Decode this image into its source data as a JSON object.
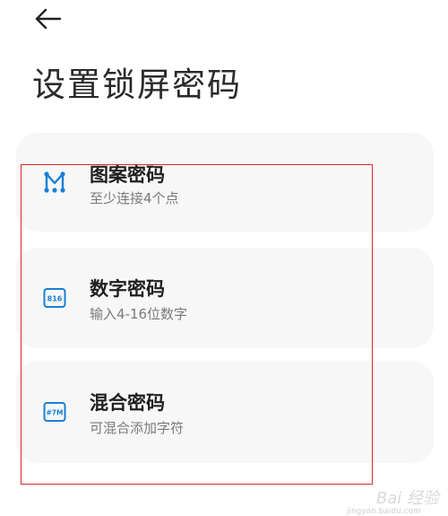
{
  "header": {
    "back_icon": "arrow-left-icon",
    "title": "设置锁屏密码"
  },
  "options": [
    {
      "icon": "pattern-lock-icon",
      "title": "图案密码",
      "subtitle": "至少连接4个点"
    },
    {
      "icon": "numeric-pin-icon",
      "icon_text": "816",
      "title": "数字密码",
      "subtitle": "输入4-16位数字"
    },
    {
      "icon": "mixed-password-icon",
      "icon_text": "#7M",
      "title": "混合密码",
      "subtitle": "可混合添加字符"
    }
  ],
  "colors": {
    "accent": "#1a7fd6",
    "highlight_border": "#d62a2a",
    "card_bg": "#f7f7f7"
  },
  "watermark": {
    "text": "Bai 经验",
    "url": "jingyan.baidu.com"
  }
}
